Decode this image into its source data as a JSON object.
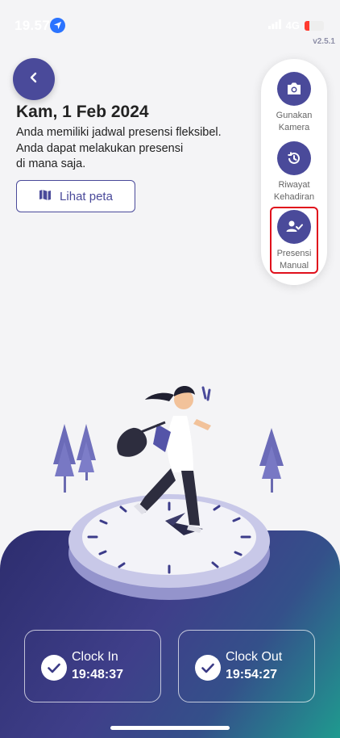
{
  "status_bar": {
    "time": "19.57",
    "network": "4G",
    "battery_level": 0.25
  },
  "version": "v2.5.1",
  "header": {
    "date": "Kam, 1 Feb 2024",
    "description": "Anda memiliki jadwal presensi fleksibel.\nAnda dapat melakukan presensi\ndi mana saja.",
    "map_button": "Lihat peta"
  },
  "side_menu": [
    {
      "label": "Gunakan\nKamera",
      "icon": "camera-icon"
    },
    {
      "label": "Riwayat\nKehadiran",
      "icon": "history-icon"
    },
    {
      "label": "Presensi\nManual",
      "icon": "user-check-icon"
    }
  ],
  "clock_in": {
    "label": "Clock In",
    "time": "19:48:37"
  },
  "clock_out": {
    "label": "Clock Out",
    "time": "19:54:27"
  },
  "colors": {
    "primary": "#4a4a9a",
    "highlight": "#e0101c",
    "gradient_end": "#1f9a8f"
  }
}
